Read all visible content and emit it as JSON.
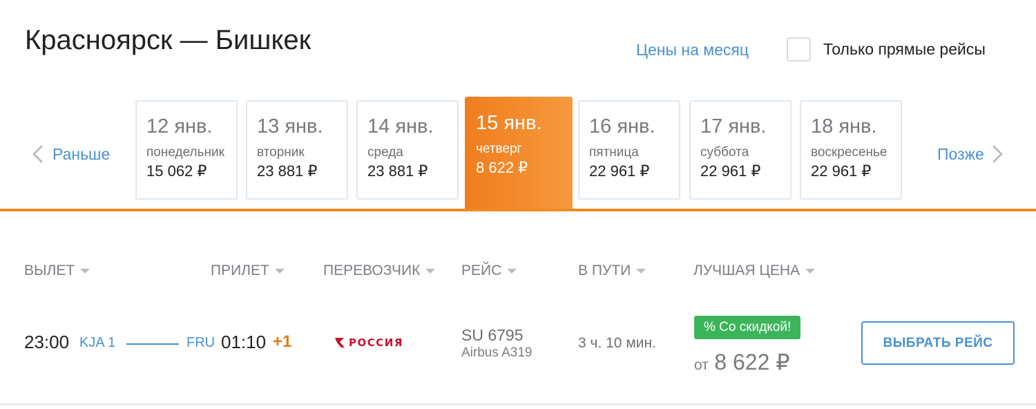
{
  "header": {
    "route_title": "Красноярск — Бишкек",
    "month_prices_link": "Цены на месяц",
    "direct_only_label": "Только прямые рейсы",
    "direct_only_checked": false
  },
  "date_nav": {
    "earlier_label": "Раньше",
    "later_label": "Позже",
    "dates": [
      {
        "date": "12 янв.",
        "weekday": "понедельник",
        "price": "15 062 ₽"
      },
      {
        "date": "13 янв.",
        "weekday": "вторник",
        "price": "23 881 ₽"
      },
      {
        "date": "14 янв.",
        "weekday": "среда",
        "price": "23 881 ₽"
      },
      {
        "date": "15 янв.",
        "weekday": "четверг",
        "price": "8 622 ₽"
      },
      {
        "date": "16 янв.",
        "weekday": "пятница",
        "price": "22 961 ₽"
      },
      {
        "date": "17 янв.",
        "weekday": "суббота",
        "price": "22 961 ₽"
      },
      {
        "date": "18 янв.",
        "weekday": "воскресенье",
        "price": "22 961 ₽"
      }
    ],
    "selected_index": 3
  },
  "columns": {
    "departure": "ВЫЛЕТ",
    "arrival": "ПРИЛЕТ",
    "carrier": "ПЕРЕВОЗЧИК",
    "flight": "РЕЙС",
    "duration": "В ПУТИ",
    "best_price": "ЛУЧШАЯ ЦЕНА"
  },
  "flight": {
    "dep_time": "23:00",
    "dep_airport": "KJA 1",
    "arr_airport": "FRU",
    "arr_time": "01:10",
    "arr_day_offset": "+1",
    "airline_name": "РОССИЯ",
    "airline_icon": "rossiya-logo-icon",
    "flight_number": "SU 6795",
    "aircraft": "Airbus A319",
    "duration": "3 ч. 10 мин.",
    "discount_badge": "% Со скидкой!",
    "price_prefix": "от",
    "price": "8 622 ₽",
    "select_button": "ВЫБРАТЬ РЕЙС"
  },
  "colors": {
    "accent_blue": "#4a90d0",
    "active_orange": "#f07d1d",
    "discount_green": "#3cb55a",
    "airline_red": "#c8102e"
  }
}
